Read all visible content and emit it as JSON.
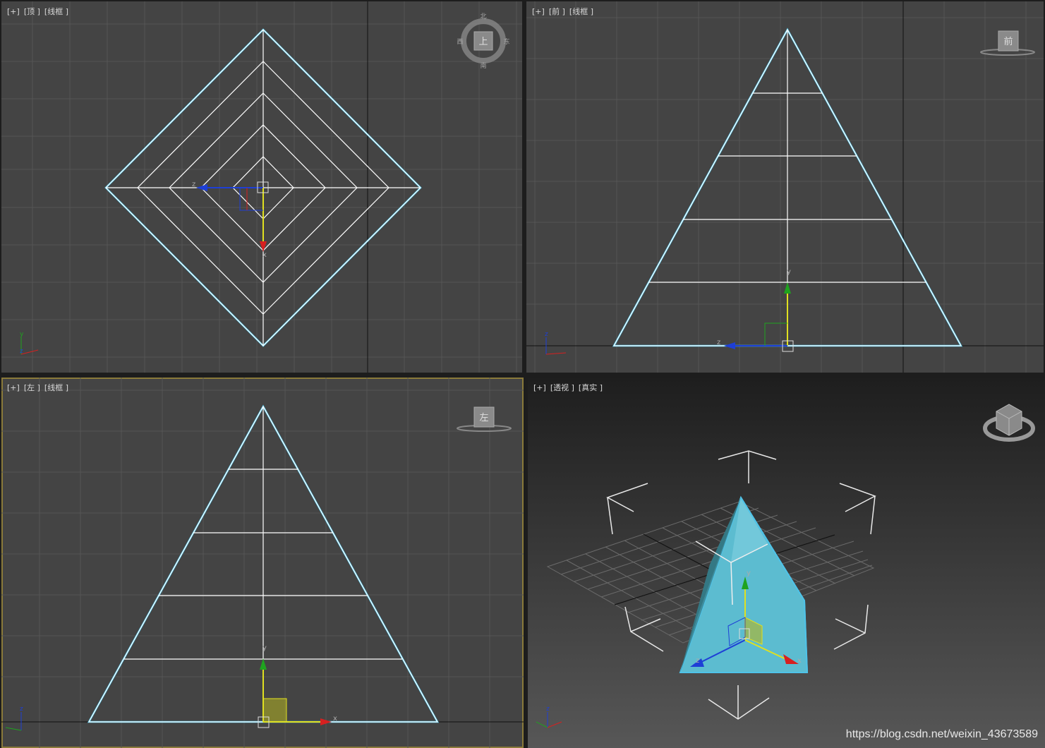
{
  "viewports": {
    "top": {
      "labels": [
        "[+]",
        "[顶 ]",
        "[线框 ]"
      ],
      "viewcube_face": "上",
      "compass": {
        "n": "北",
        "s": "南",
        "e": "东",
        "w": "西"
      }
    },
    "front": {
      "labels": [
        "[+]",
        "[前 ]",
        "[线框 ]"
      ],
      "viewcube_face": "前"
    },
    "left": {
      "labels": [
        "[+]",
        "[左 ]",
        "[线框 ]"
      ],
      "viewcube_face": "左"
    },
    "perspective": {
      "labels": [
        "[+]",
        "[透视 ]",
        "[真实 ]"
      ]
    }
  },
  "axis_labels": {
    "x": "x",
    "y": "y",
    "z": "z"
  },
  "watermark": "https://blog.csdn.net/weixin_43673589",
  "colors": {
    "viewport_bg": "#444444",
    "grid": "#555555",
    "wire": "#ffffff",
    "selection": "#4fc3e8",
    "x_axis": "#d62020",
    "y_axis": "#1fa31f",
    "z_axis": "#1e3fd6",
    "gizmo_yellow": "#e0e020",
    "pyramid_fill": "#5cbcd0",
    "active_border": "#8a7a3a"
  }
}
